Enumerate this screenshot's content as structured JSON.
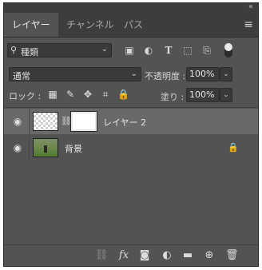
{
  "tabs": [
    {
      "label": "レイヤー",
      "active": true
    },
    {
      "label": "チャンネル",
      "active": false
    },
    {
      "label": "パス",
      "active": false
    }
  ],
  "filter": {
    "kind_label": "種類"
  },
  "blend": {
    "mode": "通常"
  },
  "opacity": {
    "label": "不透明度 :",
    "value": "100%"
  },
  "lock": {
    "label": "ロック :"
  },
  "fill": {
    "label": "塗り :",
    "value": "100%"
  },
  "layers": [
    {
      "name": "レイヤー 2",
      "selected": true,
      "visible": true,
      "has_mask": true
    },
    {
      "name": "背景",
      "selected": false,
      "visible": true,
      "locked": true
    }
  ],
  "bottom_icons": [
    "link-icon",
    "fx-icon",
    "add-mask-icon",
    "adjustment-layer-icon",
    "new-group-icon",
    "new-layer-icon",
    "trash-icon"
  ],
  "colors": {
    "panel": "#535353",
    "tabbar": "#3d3d3d",
    "selected_row": "#696969"
  }
}
